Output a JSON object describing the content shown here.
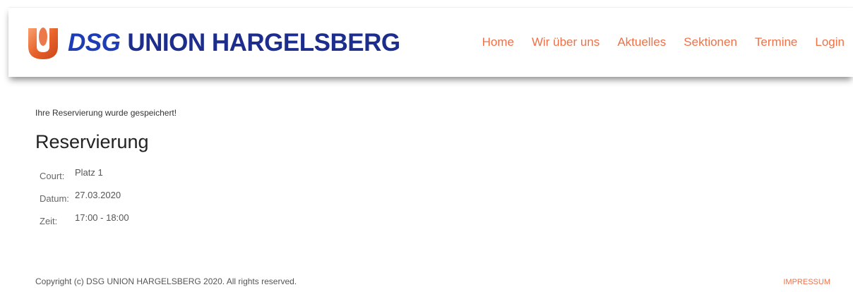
{
  "brand": {
    "logo_icon": "union-u-logo",
    "name_prefix": "DSG",
    "name": "UNION HARGELSBERG"
  },
  "nav": {
    "items": [
      "Home",
      "Wir über uns",
      "Aktuelles",
      "Sektionen",
      "Termine",
      "Login"
    ]
  },
  "main": {
    "message": "Ihre Reservierung wurde gespeichert!",
    "title": "Reservierung",
    "details": [
      {
        "label": "Court:",
        "value": "Platz 1"
      },
      {
        "label": "Datum:",
        "value": "27.03.2020"
      },
      {
        "label": "Zeit:",
        "value": "17:00 - 18:00"
      }
    ]
  },
  "footer": {
    "copyright": "Copyright (c) DSG UNION HARGELSBERG 2020. All rights reserved.",
    "impressum": "IMPRESSUM"
  },
  "colors": {
    "accent": "#ee7148",
    "brand_blue": "#1c2d8c",
    "logo_orange": "#e8622a"
  }
}
